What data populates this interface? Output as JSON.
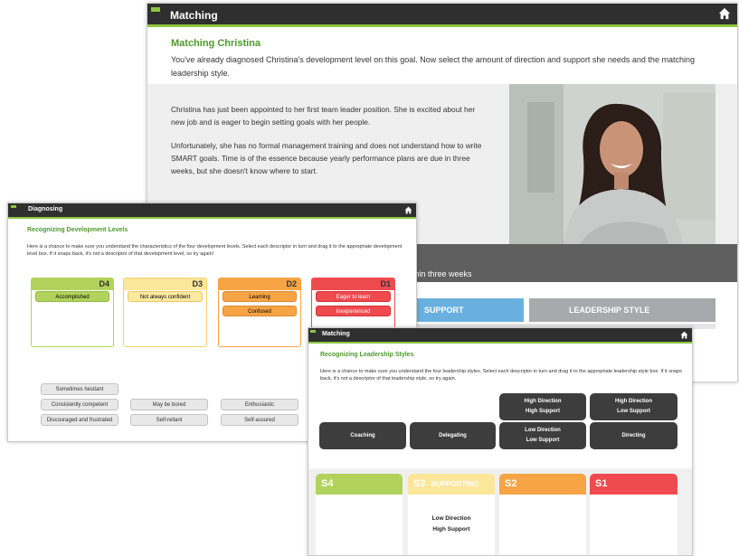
{
  "colors": {
    "green": "#8cc63f",
    "dark": "#2f2f2f",
    "heading_green": "#4d9a2a",
    "d4": "#b2d35b",
    "d3": "#fbe69a",
    "d2": "#f6a444",
    "d1": "#ef4b4f",
    "support_blue": "#6ab0de",
    "leadership_gray": "#a7a9ac"
  },
  "w1": {
    "title": "Matching",
    "home_icon": "home-icon",
    "heading": "Matching Christina",
    "intro": "You've already diagnosed Christina's development level on this goal. Now select the amount of direction and support she needs and the matching leadership style.",
    "para1": "Christina has just been appointed to her first team leader position. She is excited about her new job and is eager to begin setting goals with her people.",
    "para2": "Unfortunately, she has no formal management training and does not understand how to write SMART goals. Time is of the essence because yearly performance plans are due in three weeks, but she doesn't know where to start.",
    "band_text": "ithin three weeks",
    "support_label": "SUPPORT",
    "leadership_label": "LEADERSHIP STYLE"
  },
  "w2": {
    "title": "Diagnosing",
    "heading": "Recognizing Development Levels",
    "instructions": "Here is a chance to make sure you understand the characteristics of the four development levels. Select each descriptor in turn and drag it to the appropriate development level box. If it snaps back, it's not a descriptor of that development level, so try again!",
    "levels": [
      {
        "code": "D4",
        "chips": [
          "Accomplished"
        ]
      },
      {
        "code": "D3",
        "chips": [
          "Not always confident"
        ]
      },
      {
        "code": "D2",
        "chips": [
          "Learning",
          "Confused"
        ]
      },
      {
        "code": "D1",
        "chips": [
          "Eager to learn",
          "Inexperienced"
        ]
      }
    ],
    "descriptors": [
      "Sometimes hesitant",
      "Consistently competent",
      "May be bored",
      "Enthusiastic",
      "Discouraged and frustrated",
      "Self-reliant",
      "Self-assured"
    ]
  },
  "w3": {
    "title": "Matching",
    "heading": "Recognizing Leadership Styles",
    "instructions": "Here is a chance to make sure you understand the four leadership styles. Select each descriptor in turn and drag it to the appropriate leadership style box. If it snaps back, it's not a descriptor of that leadership style, so try again.",
    "tiles_top": [
      {
        "l1": "High Direction",
        "l2": "High Support"
      },
      {
        "l1": "High Direction",
        "l2": "Low Support"
      }
    ],
    "tiles_bottom": [
      {
        "l1": "Coaching",
        "l2": ""
      },
      {
        "l1": "Delegating",
        "l2": ""
      },
      {
        "l1": "Low Direction",
        "l2": "Low Support"
      },
      {
        "l1": "Directing",
        "l2": ""
      }
    ],
    "styles": [
      {
        "code": "S4",
        "name": ""
      },
      {
        "code": "S3",
        "name": "SUPPORTING"
      },
      {
        "code": "S2",
        "name": ""
      },
      {
        "code": "S1",
        "name": ""
      }
    ],
    "placed": {
      "l1": "Low Direction",
      "l2": "High Support"
    }
  }
}
